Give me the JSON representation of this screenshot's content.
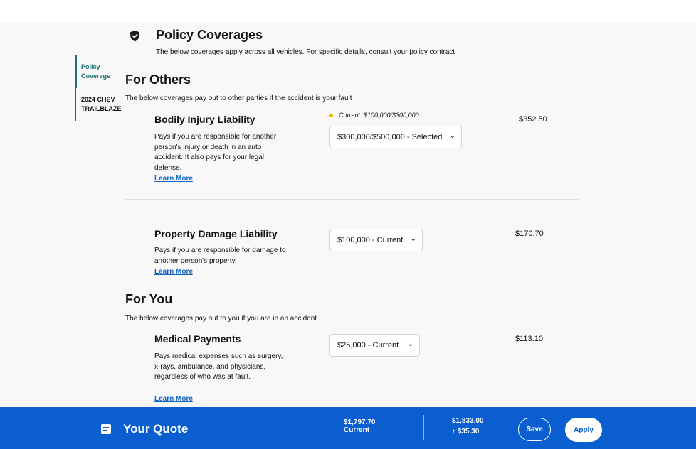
{
  "header": {
    "title": "Policy Coverages",
    "subtitle": "The below coverages apply across all vehicles. For specific details, consult your policy contract",
    "icon": "shield-check-icon"
  },
  "sidenav": {
    "items": [
      {
        "label": "Policy Coverage",
        "active": true
      },
      {
        "label": "2024 CHEV TRAILBLAZE",
        "active": false
      }
    ]
  },
  "sections": {
    "others": {
      "title": "For Others",
      "description": "The below coverages pay out to other parties if the accident is your fault"
    },
    "you": {
      "title": "For You",
      "description": "The below coverages pay out to you if you are in an accident"
    }
  },
  "coverages": {
    "bodily_injury": {
      "title": "Bodily Injury Liability",
      "description": "Pays if you are responsible for another person's injury or death in an auto accident. It also pays for your legal defense.",
      "learn_more": "Learn More",
      "current_note": "Current: $100,000/$300,000",
      "selected": "$300,000/$500,000 - Selected",
      "price": "$352.50"
    },
    "property_damage": {
      "title": "Property Damage Liability",
      "description": "Pays if you are responsible for damage to another person's property.",
      "learn_more": "Learn More",
      "selected": "$100,000 - Current",
      "price": "$170.70"
    },
    "medical_payments": {
      "title": "Medical Payments",
      "description": "Pays medical expenses such as surgery, x-rays, ambulance, and physicians, regardless of who was at fault.",
      "learn_more": "Learn More",
      "selected": "$25,000 - Current",
      "price": "$113.10"
    }
  },
  "quote": {
    "title": "Your Quote",
    "icon": "document-icon",
    "current_amount": "$1,797.70",
    "current_label": "Current",
    "new_amount": "$1,833.00",
    "delta": "$35.30",
    "save_label": "Save",
    "apply_label": "Apply"
  },
  "colors": {
    "accent": "#0a5ecf",
    "nav_active": "#1f6e6e",
    "current_dot": "#f5b400",
    "link": "#1565c0"
  }
}
